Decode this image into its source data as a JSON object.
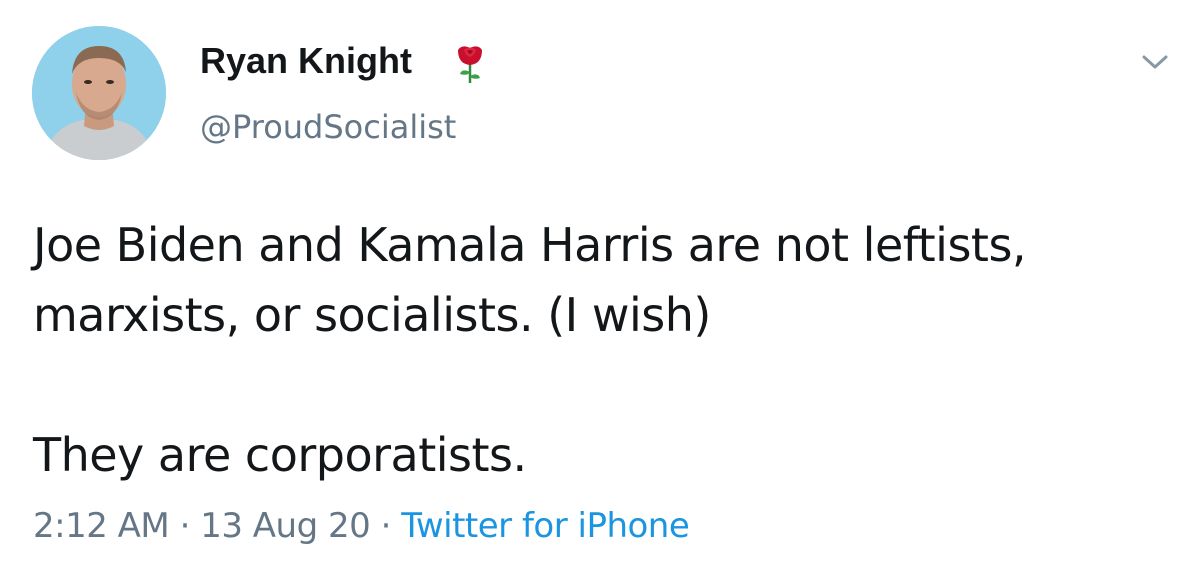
{
  "author": {
    "name": "Ryan Knight",
    "handle": "@ProudSocialist",
    "badge_icon": "rose-icon"
  },
  "tweet": {
    "lines": [
      "Joe Biden and Kamala Harris are not leftists,",
      "marxists, or socialists. (I wish)",
      "They are corporatists."
    ]
  },
  "meta": {
    "time": "2:12 AM",
    "separator": "·",
    "date": "13 Aug 20",
    "source": "Twitter for iPhone"
  },
  "icons": {
    "menu": "chevron-down-icon",
    "avatar": "profile-photo"
  },
  "colors": {
    "text": "#14171a",
    "secondary": "#657786",
    "link": "#1b95e0",
    "rose": "#c8102e"
  }
}
